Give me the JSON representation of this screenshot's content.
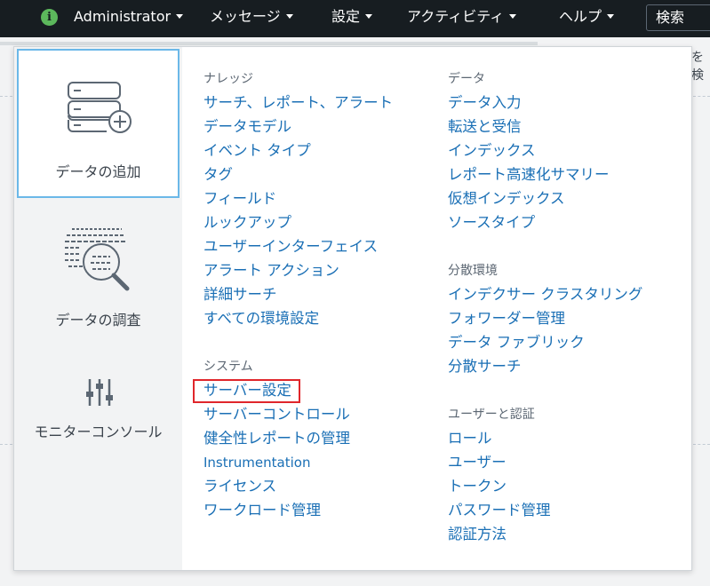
{
  "topbar": {
    "user": "Administrator",
    "menus": [
      "メッセージ",
      "設定",
      "アクティビティ",
      "ヘルプ"
    ],
    "search_label": "検索"
  },
  "background": {
    "right_text": "を検"
  },
  "sidebar": {
    "tiles": [
      {
        "label": "データの追加",
        "icon": "database-add-icon"
      },
      {
        "label": "データの調査",
        "icon": "data-explore-magnifier-icon"
      },
      {
        "label": "モニターコンソール",
        "icon": "sliders-icon"
      }
    ]
  },
  "left_column": {
    "knowledge": {
      "heading": "ナレッジ",
      "items": [
        "サーチ、レポート、アラート",
        "データモデル",
        "イベント タイプ",
        "タグ",
        "フィールド",
        "ルックアップ",
        "ユーザーインターフェイス",
        "アラート アクション",
        "詳細サーチ",
        "すべての環境設定"
      ]
    },
    "system": {
      "heading": "システム",
      "items": [
        "サーバー設定",
        "サーバーコントロール",
        "健全性レポートの管理",
        "Instrumentation",
        "ライセンス",
        "ワークロード管理"
      ],
      "highlighted": "サーバー設定"
    }
  },
  "right_column": {
    "data": {
      "heading": "データ",
      "items": [
        "データ入力",
        "転送と受信",
        "インデックス",
        "レポート高速化サマリー",
        "仮想インデックス",
        "ソースタイプ"
      ]
    },
    "distributed": {
      "heading": "分散環境",
      "items": [
        "インデクサー クラスタリング",
        "フォワーダー管理",
        "データ ファブリック",
        "分散サーチ"
      ]
    },
    "users": {
      "heading": "ユーザーと認証",
      "items": [
        "ロール",
        "ユーザー",
        "トークン",
        "パスワード管理",
        "認証方法"
      ]
    }
  },
  "colors": {
    "topbar": "#171d21",
    "link": "#1a6fb5",
    "highlight_border": "#e0262b",
    "active_tile_border": "#6bb8e8",
    "info_icon": "#5cb85c"
  }
}
